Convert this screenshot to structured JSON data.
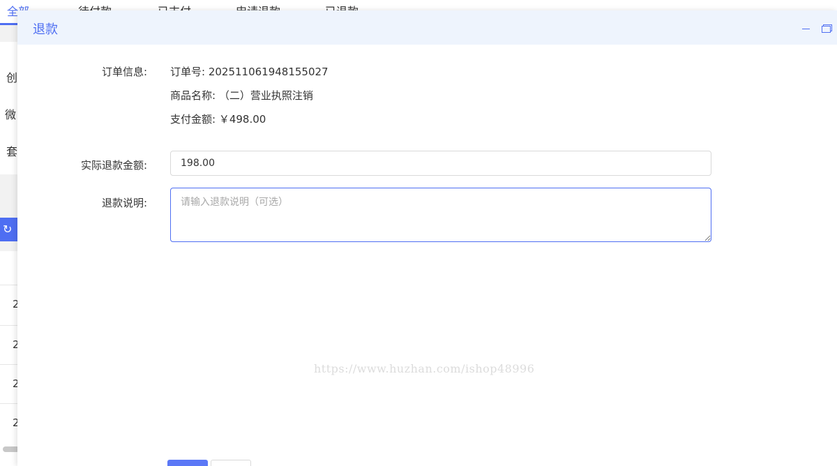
{
  "background": {
    "tabs": [
      "全部",
      "待付款",
      "已支付",
      "申请退款",
      "已退款"
    ],
    "filter_chars": [
      "创",
      "微",
      "套"
    ],
    "row_chars": [
      "2",
      "2",
      "2",
      "2"
    ],
    "refresh_icon": "↻"
  },
  "modal": {
    "title": "退款",
    "minimize_icon": "minimize-icon",
    "maximize_icon": "maximize-icon",
    "order_info_label": "订单信息:",
    "order_no": "订单号: 202511061948155027",
    "product_name": "商品名称: （二）营业执照注销",
    "paid_amount": "支付金额: ￥498.00",
    "refund_amount_label": "实际退款金额:",
    "refund_amount_value": "198.00",
    "refund_desc_label": "退款说明:",
    "refund_desc_placeholder": "请输入退款说明（可选）",
    "confirm_label": "",
    "cancel_label": ""
  },
  "watermark": "https://www.huzhan.com/ishop48996",
  "colors": {
    "accent": "#4e6ef2",
    "header_bg": "#eef4fd"
  }
}
